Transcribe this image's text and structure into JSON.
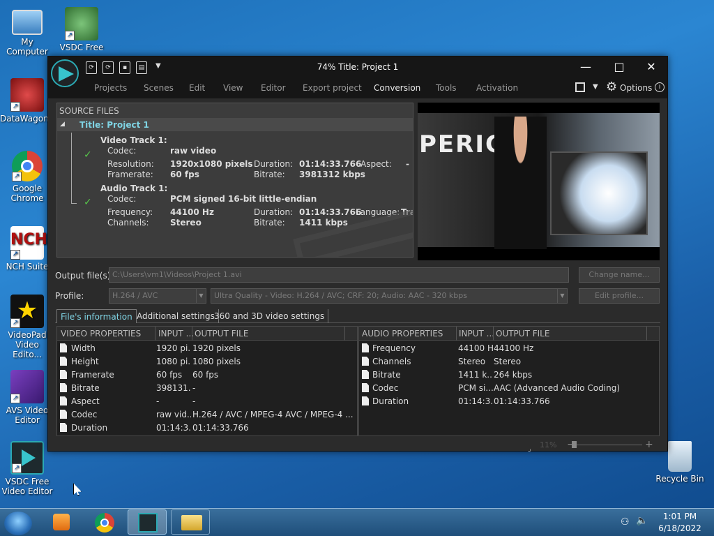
{
  "desktop": {
    "icons": [
      {
        "label": "My Computer"
      },
      {
        "label": "VSDC Free Video C..."
      },
      {
        "label": "DataWagon..."
      },
      {
        "label": "Google Chrome"
      },
      {
        "label": "NCH Suite"
      },
      {
        "label": "VideoPad Video Edito..."
      },
      {
        "label": "AVS Video Editor"
      },
      {
        "label": "VSDC Free Video Editor"
      },
      {
        "label": "Recycle Bin"
      }
    ]
  },
  "window": {
    "title": "74% Title: Project 1",
    "menu": [
      "Projects",
      "Scenes",
      "Edit",
      "View",
      "Editor",
      "Export project",
      "Conversion",
      "Tools",
      "Activation"
    ],
    "options_label": "Options",
    "source": {
      "header": "SOURCE FILES",
      "project": "Title: Project 1",
      "video_track": "Video Track 1:",
      "codec_label": "Codec:",
      "video_codec": "raw video",
      "resolution_label": "Resolution:",
      "resolution": "1920x1080 pixels",
      "duration_label": "Duration:",
      "video_duration": "01:14:33.766",
      "aspect_label": "Aspect:",
      "aspect": "-",
      "framerate_label": "Framerate:",
      "framerate": "60 fps",
      "bitrate_label": "Bitrate:",
      "video_bitrate": "3981312 kbps",
      "audio_track": "Audio Track 1:",
      "audio_codec": "PCM signed 16-bit little-endian",
      "frequency_label": "Frequency:",
      "frequency": "44100 Hz",
      "audio_duration": "01:14:33.766",
      "language_label": "Language:",
      "language": "Tra",
      "channels_label": "Channels:",
      "channels": "Stereo",
      "audio_bitrate": "1411 kbps"
    },
    "preview": {
      "overlay_text": "PERIC"
    },
    "output_label": "Output file(s):",
    "output_path": "C:\\Users\\vm1\\Videos\\Project 1.avi",
    "change_name": "Change name...",
    "profile_label": "Profile:",
    "profile_codec": "H.264 / AVC",
    "profile_quality": "Ultra Quality - Video: H.264 / AVC; CRF: 20; Audio: AAC - 320 kbps",
    "edit_profile": "Edit profile...",
    "tabs": [
      "File's information",
      "Additional settings",
      "360 and 3D video settings"
    ],
    "video_props": {
      "headers": [
        "VIDEO PROPERTIES",
        "INPUT ...",
        "OUTPUT FILE"
      ],
      "rows": [
        [
          "Width",
          "1920 pi...",
          "1920 pixels"
        ],
        [
          "Height",
          "1080 pi...",
          "1080 pixels"
        ],
        [
          "Framerate",
          "60 fps",
          "60 fps"
        ],
        [
          "Bitrate",
          "398131...",
          "-"
        ],
        [
          "Aspect",
          "-",
          "-"
        ],
        [
          "Codec",
          "raw vid...",
          "H.264 / AVC / MPEG-4 AVC / MPEG-4 ..."
        ],
        [
          "Duration",
          "01:14:3...",
          "01:14:33.766"
        ]
      ]
    },
    "audio_props": {
      "headers": [
        "AUDIO PROPERTIES",
        "INPUT ...",
        "OUTPUT FILE"
      ],
      "rows": [
        [
          "Frequency",
          "44100 Hz",
          "44100 Hz"
        ],
        [
          "Channels",
          "Stereo",
          "Stereo"
        ],
        [
          "Bitrate",
          "1411 k...",
          "264 kbps"
        ],
        [
          "Codec",
          "PCM si...",
          "AAC (Advanced Audio Coding)"
        ],
        [
          "Duration",
          "01:14:3...",
          "01:14:33.766"
        ]
      ]
    },
    "zoom": "11%"
  },
  "taskbar": {
    "time": "1:01 PM",
    "date": "6/18/2022"
  }
}
